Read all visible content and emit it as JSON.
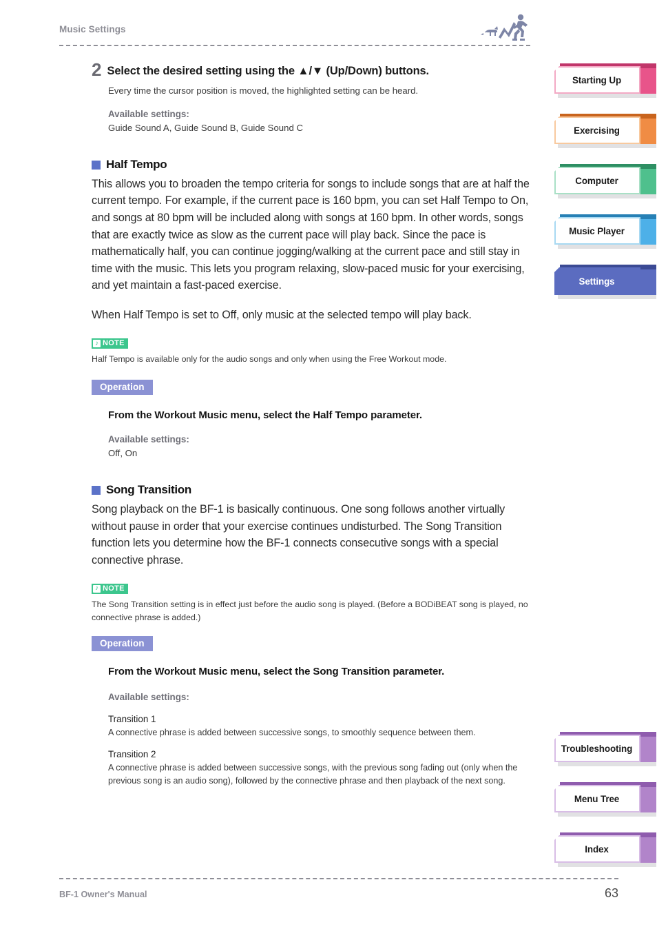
{
  "header": {
    "title": "Music Settings",
    "icon": "runner-with-dog-icon"
  },
  "footer": {
    "manual_name": "BF-1 Owner's Manual",
    "page_number": "63"
  },
  "colors": {
    "bullet_square": "#5b72c8",
    "note_badge_bg": "#3cc68d",
    "operation_badge_bg": "#8b92d4",
    "accent_starting_up": "#e8548a",
    "accent_exercising": "#f08c44",
    "accent_computer": "#4fc08d",
    "accent_music_player": "#4db0e8",
    "accent_settings": "#5b6cc0",
    "accent_reference": "#b184ca"
  },
  "main": {
    "step": {
      "number": "2",
      "title": "Select the desired setting using the ▲/▼ (Up/Down) buttons.",
      "description": "Every time the cursor position is moved, the highlighted setting can be heard.",
      "available_label": "Available settings:",
      "available_values": "Guide Sound A, Guide Sound B, Guide Sound C"
    },
    "sections": [
      {
        "heading": "Half Tempo",
        "paragraphs": [
          "This allows you to broaden the tempo criteria for songs to include songs that are at half the current tempo. For example, if the current pace is 160 bpm, you can set Half Tempo to On, and songs at 80 bpm will be included along with songs at 160 bpm. In other words, songs that are exactly twice as slow as the current pace will play back. Since the pace is mathematically half, you can continue jogging/walking at the current pace and still stay in time with the music. This lets you program relaxing, slow-paced music for your exercising, and yet maintain a fast-paced exercise.",
          "When Half Tempo is set to Off, only music at the selected tempo will play back."
        ],
        "note": {
          "badge": "NOTE",
          "glyph": "music-note",
          "text": "Half Tempo is available only for the audio songs and only when using the Free Workout mode."
        },
        "operation": {
          "badge": "Operation",
          "title": "From the Workout Music menu, select the Half Tempo parameter.",
          "available_label": "Available settings:",
          "available_values": "Off, On"
        }
      },
      {
        "heading": "Song Transition",
        "paragraphs": [
          "Song playback on the BF-1 is basically continuous. One song follows another virtually without pause in order that your exercise continues undisturbed. The Song Transition function lets you determine how the BF-1 connects consecutive songs with a special connective phrase."
        ],
        "note": {
          "badge": "NOTE",
          "glyph": "music-note",
          "text": "The Song Transition setting is in effect just before the audio song is played. (Before a BODiBEAT song is played, no connective phrase is added.)"
        },
        "operation": {
          "badge": "Operation",
          "title": "From the Workout Music menu, select the Song Transition parameter.",
          "available_label": "Available settings:",
          "options": [
            {
              "name": "Transition 1",
              "desc": "A connective phrase is added between successive songs, to smoothly sequence between them."
            },
            {
              "name": "Transition 2",
              "desc": "A connective phrase is added between successive songs, with the previous song fading out (only when the previous song is an audio song), followed by the connective phrase and then playback of the next song."
            }
          ]
        }
      }
    ]
  },
  "sidebar": {
    "top_tabs": [
      {
        "label": "Starting Up",
        "color": "#e8548a",
        "active": false
      },
      {
        "label": "Exercising",
        "color": "#f08c44",
        "active": false
      },
      {
        "label": "Computer",
        "color": "#4fc08d",
        "active": false
      },
      {
        "label": "Music Player",
        "color": "#4db0e8",
        "active": false
      },
      {
        "label": "Settings",
        "color": "#5b6cc0",
        "active": true
      }
    ],
    "bottom_tabs": [
      {
        "label": "Troubleshooting",
        "color": "#b184ca",
        "active": false
      },
      {
        "label": "Menu Tree",
        "color": "#b184ca",
        "active": false
      },
      {
        "label": "Index",
        "color": "#b184ca",
        "active": false
      }
    ]
  }
}
